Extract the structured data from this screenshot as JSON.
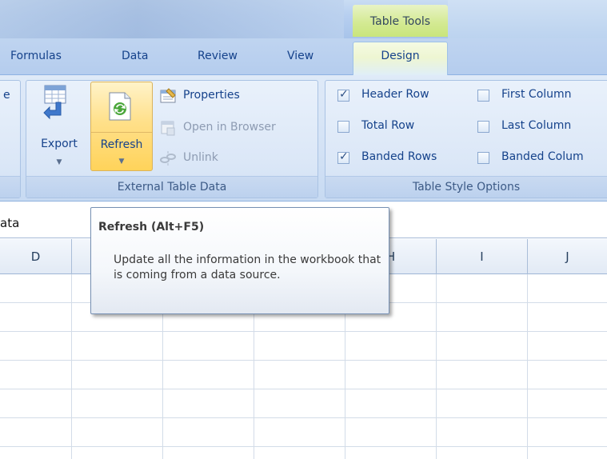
{
  "title_bar": {
    "context_tab_group": "Table Tools"
  },
  "tabs": [
    {
      "label": "Formulas"
    },
    {
      "label": "Data"
    },
    {
      "label": "Review"
    },
    {
      "label": "View"
    },
    {
      "label": "Design",
      "active": true
    }
  ],
  "ribbon": {
    "left_group_cut_label": "e",
    "external_table_data": {
      "group_label": "External Table Data",
      "export_label": "Export",
      "refresh_label": "Refresh",
      "properties_label": "Properties",
      "open_in_browser_label": "Open in Browser",
      "unlink_label": "Unlink"
    },
    "table_style_options": {
      "group_label": "Table Style Options",
      "options": [
        {
          "label": "Header Row",
          "checked": true
        },
        {
          "label": "Total Row",
          "checked": false
        },
        {
          "label": "Banded Rows",
          "checked": true
        },
        {
          "label": "First Column",
          "checked": false
        },
        {
          "label": "Last Column",
          "checked": false
        },
        {
          "label": "Banded Colum",
          "checked": false
        }
      ]
    }
  },
  "formula_bar": {
    "name_box_text": "ata"
  },
  "columns": [
    "D",
    "H",
    "I",
    "J"
  ],
  "tooltip": {
    "title": "Refresh (Alt+F5)",
    "body": "Update all the information in the workbook that is coming from a data source."
  },
  "colors": {
    "ribbon_bg": "#d3e2f5",
    "active_tab": "#eef6d2",
    "refresh_highlight": "#ffd35a",
    "tab_text": "#15428b"
  },
  "icons": {
    "export": "export-table-icon",
    "refresh": "refresh-icon",
    "properties": "properties-icon",
    "open_in_browser": "open-in-browser-icon",
    "unlink": "unlink-icon"
  }
}
